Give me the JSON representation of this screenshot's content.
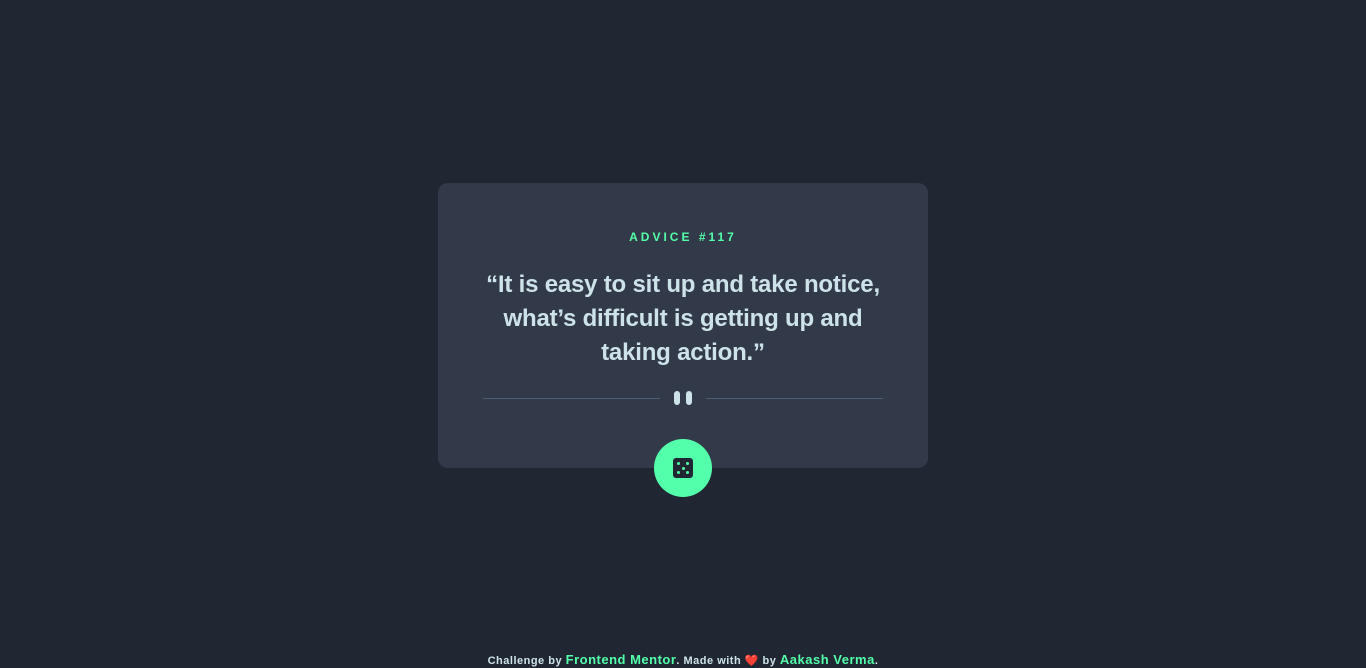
{
  "card": {
    "advice_label": "ADVICE #117",
    "quote": "“It is easy to sit up and take notice, what’s difficult is getting up and taking action.”"
  },
  "divider": {
    "icon": "pause-icon"
  },
  "dice_button": {
    "icon": "dice-icon"
  },
  "attribution": {
    "prefix": "Challenge by",
    "challenge_link": "Frontend Mentor",
    "middle": ". Made with",
    "heart": "❤️",
    "by": "by",
    "author_link": "Aakash Verma",
    "suffix": "."
  },
  "colors": {
    "background": "#202632",
    "card": "#323a49",
    "accent": "#53ffaa",
    "text": "#cee3e9"
  }
}
